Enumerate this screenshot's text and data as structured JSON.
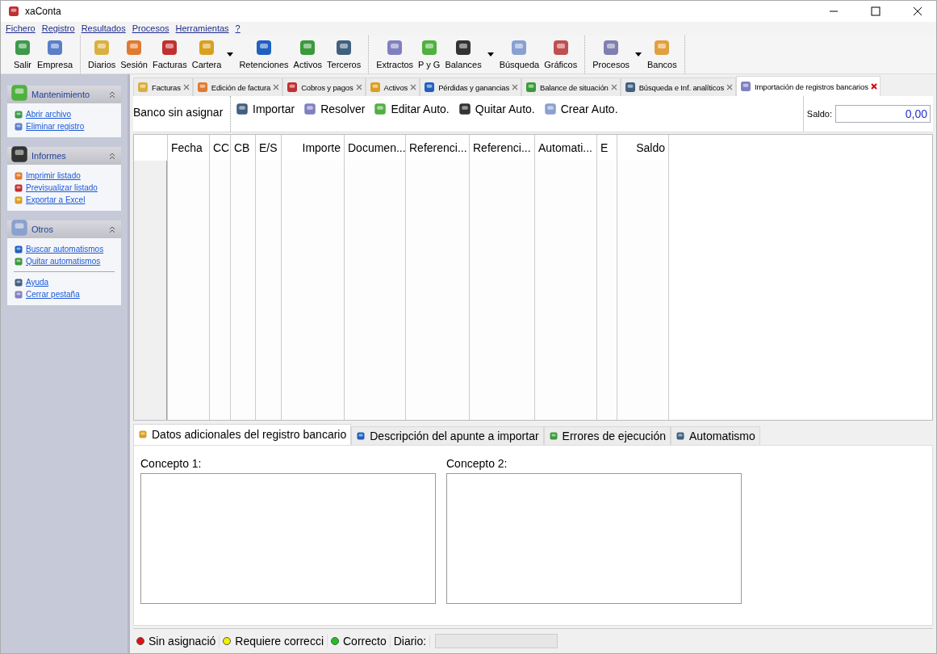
{
  "window": {
    "title": "xaConta"
  },
  "menu": [
    "Fichero",
    "Registro",
    "Resultados",
    "Procesos",
    "Herramientas",
    "?"
  ],
  "toolbar": [
    {
      "items": [
        {
          "label": "Salir",
          "dropdown": false
        },
        {
          "label": "Empresa",
          "dropdown": false
        }
      ]
    },
    {
      "items": [
        {
          "label": "Diarios",
          "dropdown": false
        },
        {
          "label": "Sesión",
          "dropdown": false
        },
        {
          "label": "Facturas",
          "dropdown": false
        },
        {
          "label": "Cartera",
          "dropdown": true
        },
        {
          "label": "Retenciones",
          "dropdown": false
        },
        {
          "label": "Activos",
          "dropdown": false
        },
        {
          "label": "Terceros",
          "dropdown": false
        }
      ]
    },
    {
      "items": [
        {
          "label": "Extractos",
          "dropdown": false
        },
        {
          "label": "P y G",
          "dropdown": false
        },
        {
          "label": "Balances",
          "dropdown": true
        },
        {
          "label": "Búsqueda",
          "dropdown": false
        },
        {
          "label": "Gráficos",
          "dropdown": false
        }
      ]
    },
    {
      "items": [
        {
          "label": "Procesos",
          "dropdown": true
        },
        {
          "label": "Bancos",
          "dropdown": false
        }
      ]
    }
  ],
  "sidebar": {
    "groups": [
      {
        "title": "Mantenimiento",
        "expanded": true,
        "sections": [
          [
            "Abrir archivo",
            "Eliminar registro"
          ]
        ]
      },
      {
        "title": "Informes",
        "expanded": true,
        "sections": [
          [
            "Imprimir listado",
            "Previsualizar listado",
            "Exportar a Excel"
          ]
        ]
      },
      {
        "title": "Otros",
        "expanded": true,
        "sections": [
          [
            "Buscar automatismos",
            "Quitar automatismos"
          ],
          [
            "Ayuda",
            "Cerrar pestaña"
          ]
        ]
      }
    ]
  },
  "doc_tabs": [
    {
      "label": "Facturas",
      "selected": false
    },
    {
      "label": "Edición de factura",
      "selected": false
    },
    {
      "label": "Cobros y pagos",
      "selected": false
    },
    {
      "label": "Activos",
      "selected": false
    },
    {
      "label": "Pérdidas y ganancias",
      "selected": false
    },
    {
      "label": "Balance de situación",
      "selected": false
    },
    {
      "label": "Búsqueda e Inf. analíticos",
      "selected": false
    },
    {
      "label": "Importación de registros bancarios",
      "selected": true
    }
  ],
  "bank_label": "Banco sin asignar",
  "actions": [
    "Importar",
    "Resolver",
    "Editar Auto.",
    "Quitar Auto.",
    "Crear Auto."
  ],
  "balance": {
    "label": "Saldo:",
    "value": "0,00"
  },
  "table": {
    "columns": [
      "Fecha",
      "CC",
      "CB",
      "E/S",
      "Importe",
      "Documen...",
      "Referenci...",
      "Referenci...",
      "Automati...",
      "E",
      "Saldo"
    ]
  },
  "detail_tabs": [
    {
      "label": "Datos adicionales del registro bancario",
      "selected": true
    },
    {
      "label": "Descripción del apunte a importar",
      "selected": false
    },
    {
      "label": "Errores de ejecución",
      "selected": false
    },
    {
      "label": "Automatismo",
      "selected": false
    }
  ],
  "concepts": [
    {
      "label": "Concepto 1:"
    },
    {
      "label": "Concepto 2:"
    }
  ],
  "status_bar": {
    "legend": [
      {
        "label": "Sin asignació",
        "color": "#e01010"
      },
      {
        "label": "Requiere correcci",
        "color": "#f0f000"
      },
      {
        "label": "Correcto",
        "color": "#20c020"
      }
    ],
    "diario": {
      "label": "Diario:",
      "level": 0
    }
  }
}
